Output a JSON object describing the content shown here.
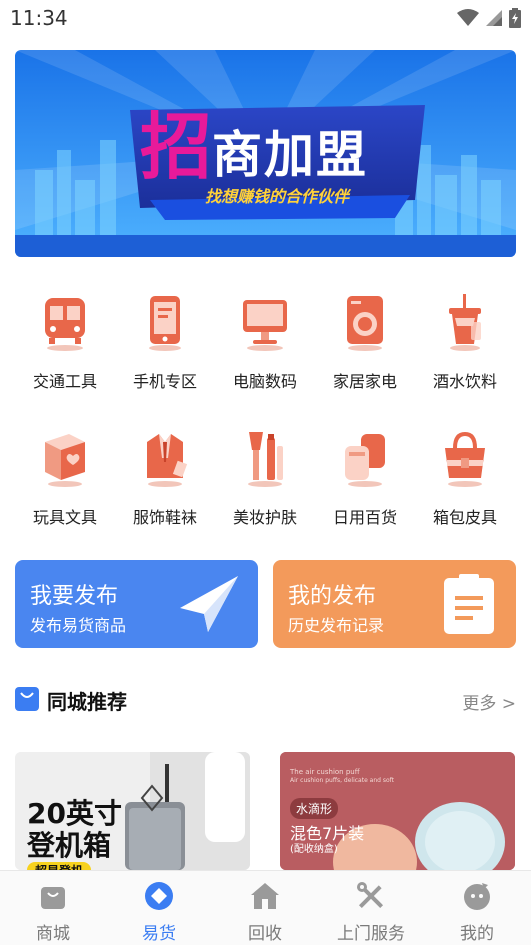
{
  "status_bar": {
    "time": "11:34"
  },
  "banner": {
    "title_big": "招",
    "title_rest": "商加盟",
    "subtitle": "找想赚钱的合作伙伴"
  },
  "categories": [
    {
      "label": "交通工具",
      "icon": "bus-icon"
    },
    {
      "label": "手机专区",
      "icon": "phone-icon"
    },
    {
      "label": "电脑数码",
      "icon": "computer-icon"
    },
    {
      "label": "家居家电",
      "icon": "washing-machine-icon"
    },
    {
      "label": "酒水饮料",
      "icon": "drink-cup-icon"
    },
    {
      "label": "玩具文具",
      "icon": "gift-box-icon"
    },
    {
      "label": "服饰鞋袜",
      "icon": "suit-icon"
    },
    {
      "label": "美妆护肤",
      "icon": "makeup-brush-icon"
    },
    {
      "label": "日用百货",
      "icon": "daily-goods-icon"
    },
    {
      "label": "箱包皮具",
      "icon": "handbag-icon"
    }
  ],
  "publish": {
    "primary": {
      "title": "我要发布",
      "subtitle": "发布易货商品",
      "color": "#4a86f0"
    },
    "secondary": {
      "title": "我的发布",
      "subtitle": "历史发布记录",
      "color": "#f39a5b"
    }
  },
  "section": {
    "title": "同城推荐",
    "more": "更多 >"
  },
  "products": [
    {
      "line1": "20英寸",
      "line2": "登机箱",
      "tag": "超显登机"
    },
    {
      "small_text": "The air cushion puff",
      "small_text2": "Air cushion puffs, delicate and soft",
      "tag": "水滴形",
      "line1": "混色7片装",
      "line2": "(配收纳盒)"
    }
  ],
  "tabs": [
    {
      "label": "商城",
      "icon": "shop-bag-icon"
    },
    {
      "label": "易货",
      "icon": "barter-icon"
    },
    {
      "label": "回收",
      "icon": "home-recycle-icon"
    },
    {
      "label": "上门服务",
      "icon": "tools-icon"
    },
    {
      "label": "我的",
      "icon": "profile-icon"
    }
  ],
  "colors": {
    "accent": "#3b7df2",
    "icon_orange": "#e8674a"
  }
}
